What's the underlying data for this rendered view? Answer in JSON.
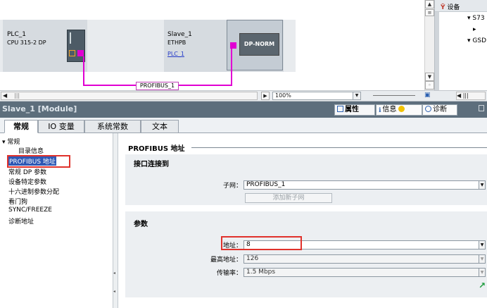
{
  "network": {
    "plc": {
      "name": "PLC_1",
      "type": "CPU 315-2 DP"
    },
    "slave": {
      "name": "Slave_1",
      "type": "ETHPB",
      "link": "PLC_1",
      "module": "DP-NORM"
    },
    "bus_label": "PROFIBUS_1",
    "zoom": "100%"
  },
  "device_panel": {
    "title": "设备",
    "rows": [
      "S73",
      "",
      "GSD"
    ]
  },
  "properties_header": {
    "title": "Slave_1 [Module]",
    "tabs": [
      {
        "label": "属性",
        "active": true
      },
      {
        "label": "信息",
        "active": false
      },
      {
        "label": "诊断",
        "active": false
      }
    ]
  },
  "tabs": [
    "常规",
    "IO 变量",
    "系统常数",
    "文本"
  ],
  "nav": {
    "items": [
      {
        "label": "▾ 常规",
        "indent": 0
      },
      {
        "label": "目录信息",
        "indent": 1
      },
      {
        "label": "PROFIBUS 地址",
        "indent": 0,
        "selected": true
      },
      {
        "label": "常规 DP 参数",
        "indent": 0
      },
      {
        "label": "设备特定参数",
        "indent": 0
      },
      {
        "label": "十六进制参数分配",
        "indent": 0
      },
      {
        "label": "看门狗",
        "indent": 0
      },
      {
        "label": "SYNC/FREEZE",
        "indent": 0
      },
      {
        "label": "诊断地址",
        "indent": 0
      }
    ]
  },
  "form": {
    "section_title": "PROFIBUS 地址",
    "interface": {
      "title": "接口连接到",
      "subnet_label": "子网：",
      "subnet_value": "PROFIBUS_1",
      "add_subnet_button": "添加新子网"
    },
    "params": {
      "title": "参数",
      "address_label": "地址：",
      "address_value": "8",
      "max_address_label": "最高地址：",
      "max_address_value": "126",
      "baud_label": "传输率：",
      "baud_value": "1.5 Mbps"
    }
  },
  "colors": {
    "bus": "#e100d2",
    "header": "#5d6e7c",
    "selection": "#2e58b5",
    "highlight_box": "#e0322c"
  }
}
